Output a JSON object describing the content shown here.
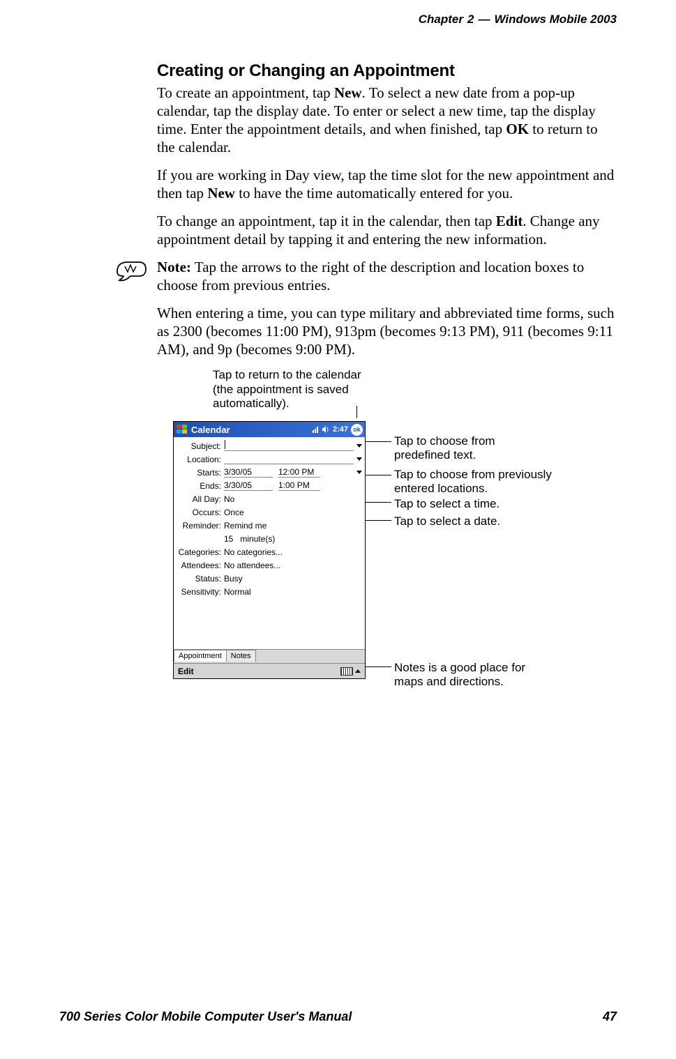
{
  "header": {
    "chapter": "Chapter",
    "chapter_num": "2",
    "dash": "—",
    "title": "Windows Mobile 2003"
  },
  "heading": "Creating or Changing an Appointment",
  "p1_a": "To create an appointment, tap ",
  "p1_b1": "New",
  "p1_c": ". To select a new date from a pop-up calendar, tap the display date. To enter or select a new time, tap the display time. Enter the appointment details, and when finished, tap ",
  "p1_b2": "OK",
  "p1_d": " to return to the calendar.",
  "p2_a": "If you are working in Day view, tap the time slot for the new appointment and then tap ",
  "p2_b": "New",
  "p2_c": " to have the time automatically entered for you.",
  "p3_a": "To change an appointment, tap it in the calendar, then tap ",
  "p3_b": "Edit",
  "p3_c": ". Change any appointment detail by tapping it and entering the new information.",
  "note_b": "Note:",
  "note": " Tap the arrows to the right of the description and location boxes to choose from previous entries.",
  "p4": "When entering a time, you can type military and abbreviated time forms, such as 2300 (becomes 11:00 PM), 913pm (becomes 9:13 PM), 911 (becomes 9:11 AM), and 9p (becomes 9:00 PM).",
  "callouts": {
    "top": "Tap to return to the calendar (the appointment is saved automatically).",
    "r1": "Tap to choose from predefined text.",
    "r2": "Tap to choose from previously entered locations.",
    "r3": "Tap to select a time.",
    "r4": "Tap to select a date.",
    "r5": "Notes is a good place for maps and directions."
  },
  "pda": {
    "title": "Calendar",
    "time": "2:47",
    "ok": "ok",
    "labels": {
      "subject": "Subject:",
      "location": "Location:",
      "starts": "Starts:",
      "ends": "Ends:",
      "allday": "All Day:",
      "occurs": "Occurs:",
      "reminder": "Reminder:",
      "categories": "Categories:",
      "attendees": "Attendees:",
      "status": "Status:",
      "sensitivity": "Sensitivity:"
    },
    "values": {
      "start_date": "3/30/05",
      "start_time": "12:00 PM",
      "end_date": "3/30/05",
      "end_time": "1:00 PM",
      "allday": "No",
      "occurs": "Once",
      "reminder1": "Remind me",
      "reminder2a": "15",
      "reminder2b": "minute(s)",
      "categories": "No categories...",
      "attendees": "No attendees...",
      "status": "Busy",
      "sensitivity": "Normal"
    },
    "tabs": {
      "t1": "Appointment",
      "t2": "Notes"
    },
    "cmd": "Edit"
  },
  "footer": {
    "left": "700 Series Color Mobile Computer User's Manual",
    "right": "47"
  }
}
